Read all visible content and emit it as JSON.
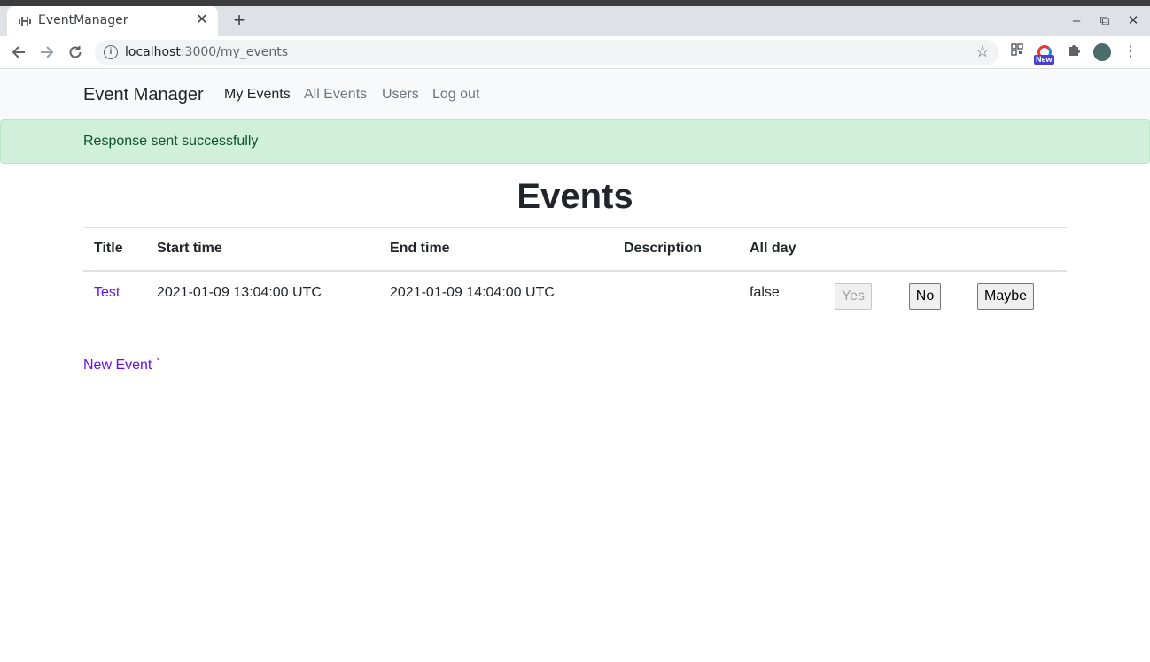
{
  "browser": {
    "tab_title": "EventManager",
    "tab_close": "✕",
    "new_tab": "+",
    "url_host": "localhost",
    "url_path": ":3000/my_events",
    "window_controls": [
      "–",
      "⧉",
      "✕"
    ]
  },
  "navbar": {
    "brand": "Event Manager",
    "links": [
      {
        "label": "My Events",
        "active": true
      },
      {
        "label": "All Events",
        "active": false
      },
      {
        "label": "Users",
        "active": false
      },
      {
        "label": "Log out",
        "active": false
      }
    ]
  },
  "alert": {
    "message": "Response sent successfully",
    "bg_color": "#d1f0db",
    "text_color": "#0f5132"
  },
  "page": {
    "heading": "Events"
  },
  "table": {
    "columns": [
      "Title",
      "Start time",
      "End time",
      "Description",
      "All day"
    ],
    "rows": [
      {
        "title": "Test",
        "start_time": "2021-01-09 13:04:00 UTC",
        "end_time": "2021-01-09 14:04:00 UTC",
        "description": "",
        "all_day": "false",
        "actions": {
          "yes": "Yes",
          "no": "No",
          "maybe": "Maybe"
        }
      }
    ]
  },
  "new_event_link": "New Event `",
  "icons": {
    "tab": "dumbbell-icon",
    "back": "back-arrow-icon",
    "forward": "forward-arrow-icon",
    "reload": "reload-icon",
    "info": "info-icon",
    "bookmark": "star-icon",
    "extensions": "puzzle-icon",
    "menu": "kebab-menu-icon"
  },
  "accent_color": "#6610f2"
}
